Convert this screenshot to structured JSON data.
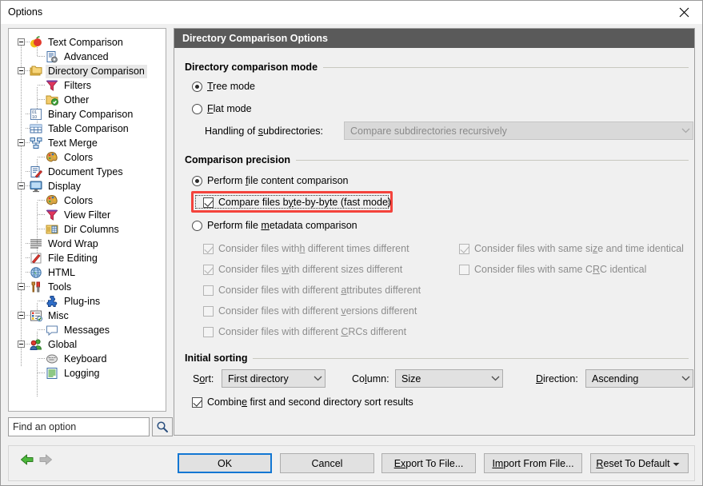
{
  "window": {
    "title": "Options",
    "close_icon": "close-icon"
  },
  "sidebar": {
    "search": {
      "placeholder": "Find an option",
      "value": "",
      "button_icon": "search-icon"
    },
    "items": [
      {
        "label": "Text Comparison",
        "level": 0,
        "icon": "apple-icon",
        "expander": "collapse",
        "selected": false
      },
      {
        "label": "Advanced",
        "level": 1,
        "icon": "document-gear-icon",
        "expander": "none",
        "selected": false
      },
      {
        "label": "Directory Comparison",
        "level": 0,
        "icon": "folders-icon",
        "expander": "collapse",
        "selected": true
      },
      {
        "label": "Filters",
        "level": 1,
        "icon": "funnel-icon",
        "expander": "none",
        "selected": false
      },
      {
        "label": "Other",
        "level": 1,
        "icon": "folder-check-icon",
        "expander": "none",
        "selected": false
      },
      {
        "label": "Binary Comparison",
        "level": 0,
        "icon": "binary-icon",
        "expander": "none",
        "selected": false
      },
      {
        "label": "Table Comparison",
        "level": 0,
        "icon": "table-icon",
        "expander": "none",
        "selected": false
      },
      {
        "label": "Text Merge",
        "level": 0,
        "icon": "merge-icon",
        "expander": "collapse",
        "selected": false
      },
      {
        "label": "Colors",
        "level": 1,
        "icon": "palette-icon",
        "expander": "none",
        "selected": false
      },
      {
        "label": "Document Types",
        "level": 0,
        "icon": "document-pen-icon",
        "expander": "none",
        "selected": false
      },
      {
        "label": "Display",
        "level": 0,
        "icon": "monitor-icon",
        "expander": "collapse",
        "selected": false
      },
      {
        "label": "Colors",
        "level": 1,
        "icon": "palette-icon",
        "expander": "none",
        "selected": false
      },
      {
        "label": "View Filter",
        "level": 1,
        "icon": "funnel-icon",
        "expander": "none",
        "selected": false
      },
      {
        "label": "Dir Columns",
        "level": 1,
        "icon": "columns-icon",
        "expander": "none",
        "selected": false
      },
      {
        "label": "Word Wrap",
        "level": 0,
        "icon": "lines-icon",
        "expander": "none",
        "selected": false
      },
      {
        "label": "File Editing",
        "level": 0,
        "icon": "pencil-icon",
        "expander": "none",
        "selected": false
      },
      {
        "label": "HTML",
        "level": 0,
        "icon": "globe-icon",
        "expander": "none",
        "selected": false
      },
      {
        "label": "Tools",
        "level": 0,
        "icon": "tools-icon",
        "expander": "collapse",
        "selected": false
      },
      {
        "label": "Plug-ins",
        "level": 1,
        "icon": "puzzle-icon",
        "expander": "none",
        "selected": false
      },
      {
        "label": "Misc",
        "level": 0,
        "icon": "misc-icon",
        "expander": "collapse",
        "selected": false
      },
      {
        "label": "Messages",
        "level": 1,
        "icon": "speech-icon",
        "expander": "none",
        "selected": false
      },
      {
        "label": "Global",
        "level": 0,
        "icon": "people-icon",
        "expander": "collapse",
        "selected": false
      },
      {
        "label": "Keyboard",
        "level": 1,
        "icon": "keyboard-icon",
        "expander": "none",
        "selected": false
      },
      {
        "label": "Logging",
        "level": 1,
        "icon": "log-icon",
        "expander": "none",
        "selected": false
      }
    ]
  },
  "pane": {
    "header": "Directory Comparison Options",
    "groups": {
      "mode": {
        "title": "Directory comparison mode",
        "tree_mode": {
          "label_pre": "",
          "accel": "T",
          "label_post": "ree mode",
          "checked": true
        },
        "flat_mode": {
          "label_pre": "",
          "accel": "F",
          "label_post": "lat mode",
          "checked": false
        },
        "subdir_label_pre": "Handling of ",
        "subdir_accel": "s",
        "subdir_label_post": "ubdirectories:",
        "subdir_value": "Compare subdirectories recursively",
        "subdir_disabled": true
      },
      "precision": {
        "title": "Comparison precision",
        "content_radio": {
          "pre": "Perform ",
          "accel": "f",
          "post": "ile content comparison",
          "checked": true
        },
        "byte_checkbox": {
          "pre": "Compare files b",
          "accel": "y",
          "post": "te-by-byte (fast mode)",
          "checked": true,
          "highlighted": true
        },
        "metadata_radio": {
          "pre": "Perform file ",
          "accel": "m",
          "post": "etadata comparison",
          "checked": false
        },
        "left_options": [
          {
            "pre": "Consider files with",
            "accel": "h",
            "post": " different times different",
            "checked": true,
            "disabled": true
          },
          {
            "pre": "Consider files ",
            "accel": "w",
            "post": "ith different sizes different",
            "checked": true,
            "disabled": true
          },
          {
            "pre": "Consider files with different ",
            "accel": "a",
            "post": "ttributes different",
            "checked": false,
            "disabled": true
          },
          {
            "pre": "Consider files with different ",
            "accel": "v",
            "post": "ersions different",
            "checked": false,
            "disabled": true
          },
          {
            "pre": "Consider files with different ",
            "accel": "C",
            "post": "RCs different",
            "checked": false,
            "disabled": true
          }
        ],
        "right_options": [
          {
            "pre": "Consider files with same si",
            "accel": "z",
            "post": "e and time identical",
            "checked": true,
            "disabled": true
          },
          {
            "pre": "Consider files with same C",
            "accel": "R",
            "post": "C identical",
            "checked": false,
            "disabled": true
          }
        ]
      },
      "sorting": {
        "title": "Initial sorting",
        "sort_label_pre": "S",
        "sort_accel": "o",
        "sort_label_post": "rt:",
        "sort_value": "First directory",
        "column_label_pre": "Co",
        "column_accel": "l",
        "column_label_post": "umn:",
        "column_value": "Size",
        "direction_label_pre": "",
        "direction_accel": "D",
        "direction_label_post": "irection:",
        "direction_value": "Ascending",
        "combine": {
          "pre": "Combin",
          "accel": "e",
          "post": " first and second directory sort results",
          "checked": true
        }
      }
    }
  },
  "footer": {
    "back_icon": "arrow-left-icon",
    "forward_icon": "arrow-right-icon",
    "buttons": {
      "ok": "OK",
      "cancel": "Cancel",
      "export_pre": "E",
      "export_accel": "x",
      "export_post": "port To File...",
      "import_pre": "I",
      "import_accel": "m",
      "import_post": "port From File...",
      "reset_pre": "",
      "reset_accel": "R",
      "reset_post": "eset To Default"
    }
  },
  "colors": {
    "header_bg": "#5a5a5a",
    "dialog_bg": "#f0f0f0",
    "highlight_red": "#f4433c",
    "focus_blue": "#1277d3",
    "arrow_green": "#3fab32",
    "arrow_gray": "#b0b0b0"
  }
}
